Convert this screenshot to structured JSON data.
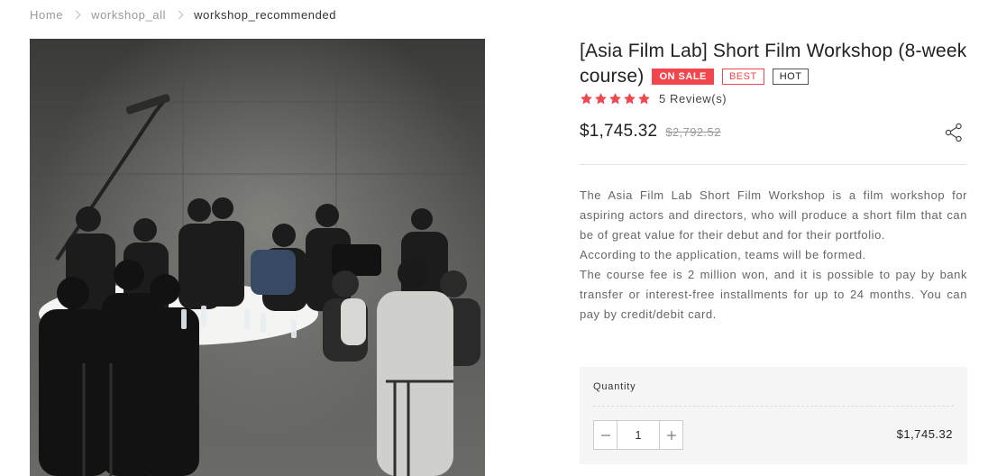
{
  "breadcrumb": {
    "home": "Home",
    "category": "workshop_all",
    "current": "workshop_recommended"
  },
  "product": {
    "title": "[Asia Film Lab] Short Film Workshop (8-week course)",
    "badges": {
      "sale": "ON SALE",
      "best": "BEST",
      "hot": "HOT"
    },
    "rating_stars": 5,
    "review_count": "5 Review(s)",
    "price": "$1,745.32",
    "original_price": "$2,792.52",
    "description": [
      "The Asia Film Lab Short Film Workshop is a film workshop for aspiring actors and directors, who will produce a short film that can be of great value for their debut and for their portfolio.",
      "According to the application, teams will be formed.",
      "The course fee is 2 million won, and it is possible to pay by bank transfer or interest-free installments for up to 24 months. You can pay by credit/debit card."
    ]
  },
  "purchase": {
    "quantity_label": "Quantity",
    "quantity": "1",
    "total": "$1,745.32"
  },
  "icons": {
    "share": "share-icon",
    "star": "star-icon",
    "minus": "minus-icon",
    "plus": "plus-icon"
  },
  "colors": {
    "accent": "#f2464e",
    "star": "#f2464e"
  }
}
